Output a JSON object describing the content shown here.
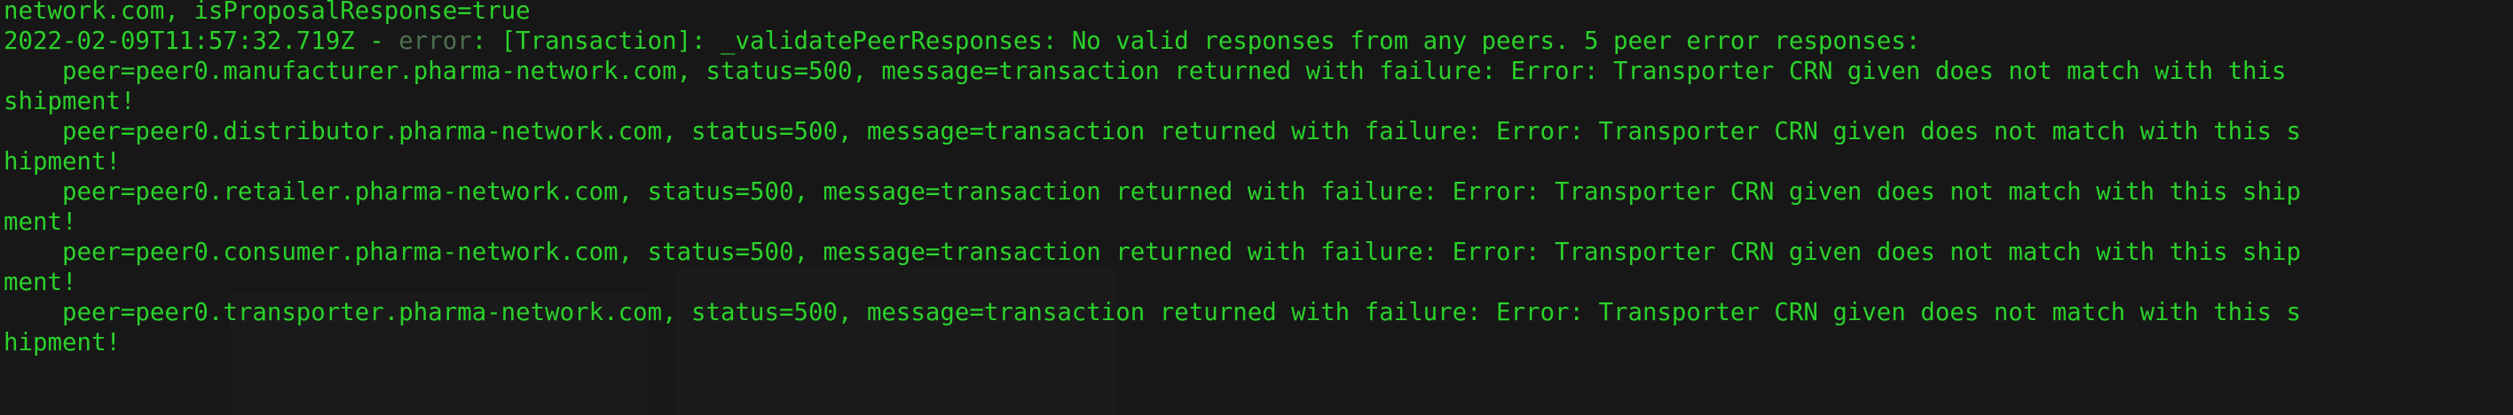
{
  "terminal": {
    "text_color": "#2bd12b",
    "dim_color": "#4e6e4e",
    "background": "#171717",
    "lines": [
      {
        "text": "network.com, isProposalResponse=true"
      },
      {
        "pre": "2022-02-09T11:57:32.719Z - ",
        "level": "error",
        "post": ": [Transaction]: _validatePeerResponses: No valid responses from any peers. 5 peer error responses:"
      },
      {
        "text": "    peer=peer0.manufacturer.pharma-network.com, status=500, message=transaction returned with failure: Error: Transporter CRN given does not match with this"
      },
      {
        "text": "shipment!"
      },
      {
        "text": "    peer=peer0.distributor.pharma-network.com, status=500, message=transaction returned with failure: Error: Transporter CRN given does not match with this s"
      },
      {
        "text": "hipment!"
      },
      {
        "text": "    peer=peer0.retailer.pharma-network.com, status=500, message=transaction returned with failure: Error: Transporter CRN given does not match with this ship"
      },
      {
        "text": "ment!"
      },
      {
        "text": "    peer=peer0.consumer.pharma-network.com, status=500, message=transaction returned with failure: Error: Transporter CRN given does not match with this ship"
      },
      {
        "text": "ment!"
      },
      {
        "text": "    peer=peer0.transporter.pharma-network.com, status=500, message=transaction returned with failure: Error: Transporter CRN given does not match with this s"
      },
      {
        "text": "hipment!"
      }
    ]
  }
}
